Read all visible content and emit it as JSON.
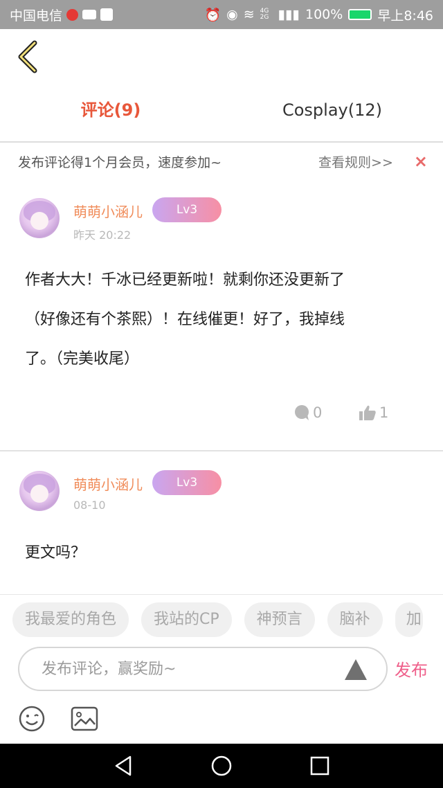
{
  "status_bar": {
    "carrier": "中国电信",
    "battery": "100%",
    "time": "早上8:46",
    "network": "4G 2G"
  },
  "tabs": [
    {
      "label": "评论(9)",
      "active": true
    },
    {
      "label": "Cosplay(12)",
      "active": false
    }
  ],
  "notice": {
    "text": "发布评论得1个月会员，速度参加~",
    "rules_link": "查看规则>>",
    "close": "×"
  },
  "comments": [
    {
      "username": "萌萌小涵儿",
      "level": "Lv3",
      "time": "昨天 20:22",
      "lines": [
        "作者大大！千冰已经更新啦！就剩你还没更新了",
        "（好像还有个茶熙）！在线催更！好了，我掉线",
        "了。（完美收尾）"
      ],
      "reply_count": "0",
      "like_count": "1"
    },
    {
      "username": "萌萌小涵儿",
      "level": "Lv3",
      "time": "08-10",
      "lines": [
        "更文吗？"
      ]
    }
  ],
  "tag_chips": [
    "我最爱的角色",
    "我站的CP",
    "神预言",
    "脑补",
    "加"
  ],
  "input": {
    "placeholder": "发布评论，赢奖励~",
    "value": "",
    "publish_label": "发布"
  },
  "icons": [
    "back-chevron-icon",
    "comment-bubble-icon",
    "thumbs-up-icon",
    "emoji-icon",
    "image-icon",
    "send-triangle-icon",
    "nav-back-icon",
    "nav-home-icon",
    "nav-recent-icon"
  ],
  "colors": {
    "accent": "#e8573a",
    "username": "#f08c5a",
    "publish": "#ef5f8a",
    "close": "#e86a6a"
  }
}
